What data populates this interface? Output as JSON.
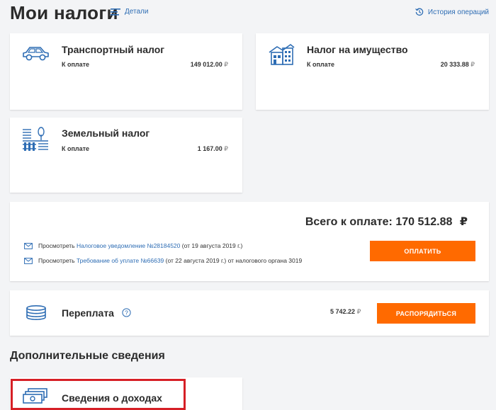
{
  "header": {
    "title": "Мои налоги",
    "details_label": "Детали",
    "history_label": "История операций"
  },
  "taxes": [
    {
      "title": "Транспортный налог",
      "label": "К оплате",
      "amount": "149 012.00",
      "icon": "car-icon"
    },
    {
      "title": "Налог на имущество",
      "label": "К оплате",
      "amount": "20 333.88",
      "icon": "house-icon"
    },
    {
      "title": "Земельный налог",
      "label": "К оплате",
      "amount": "1 167.00",
      "icon": "land-icon"
    }
  ],
  "currency": "₽",
  "payment": {
    "total_label": "Всего к оплате: 170 512.88",
    "currency": "₽",
    "notice": {
      "prefix": "Просмотреть",
      "link": "Налоговое уведомление №28184520",
      "suffix": "(от 19 августа 2019 г.)"
    },
    "demand": {
      "prefix": "Просмотреть",
      "link": "Требование об уплате №66639",
      "suffix": "(от 22 августа 2019 г.) от налогового органа 3019"
    },
    "pay_button": "ОПЛАТИТЬ"
  },
  "overpayment": {
    "title": "Переплата",
    "amount": "5 742.22",
    "currency": "₽",
    "button": "РАСПОРЯДИТЬСЯ"
  },
  "additional": {
    "section_title": "Дополнительные сведения",
    "income_title": "Сведения о доходах"
  },
  "colors": {
    "accent": "#ff6a00",
    "link": "#2e6db4",
    "highlight": "#d61f26"
  }
}
